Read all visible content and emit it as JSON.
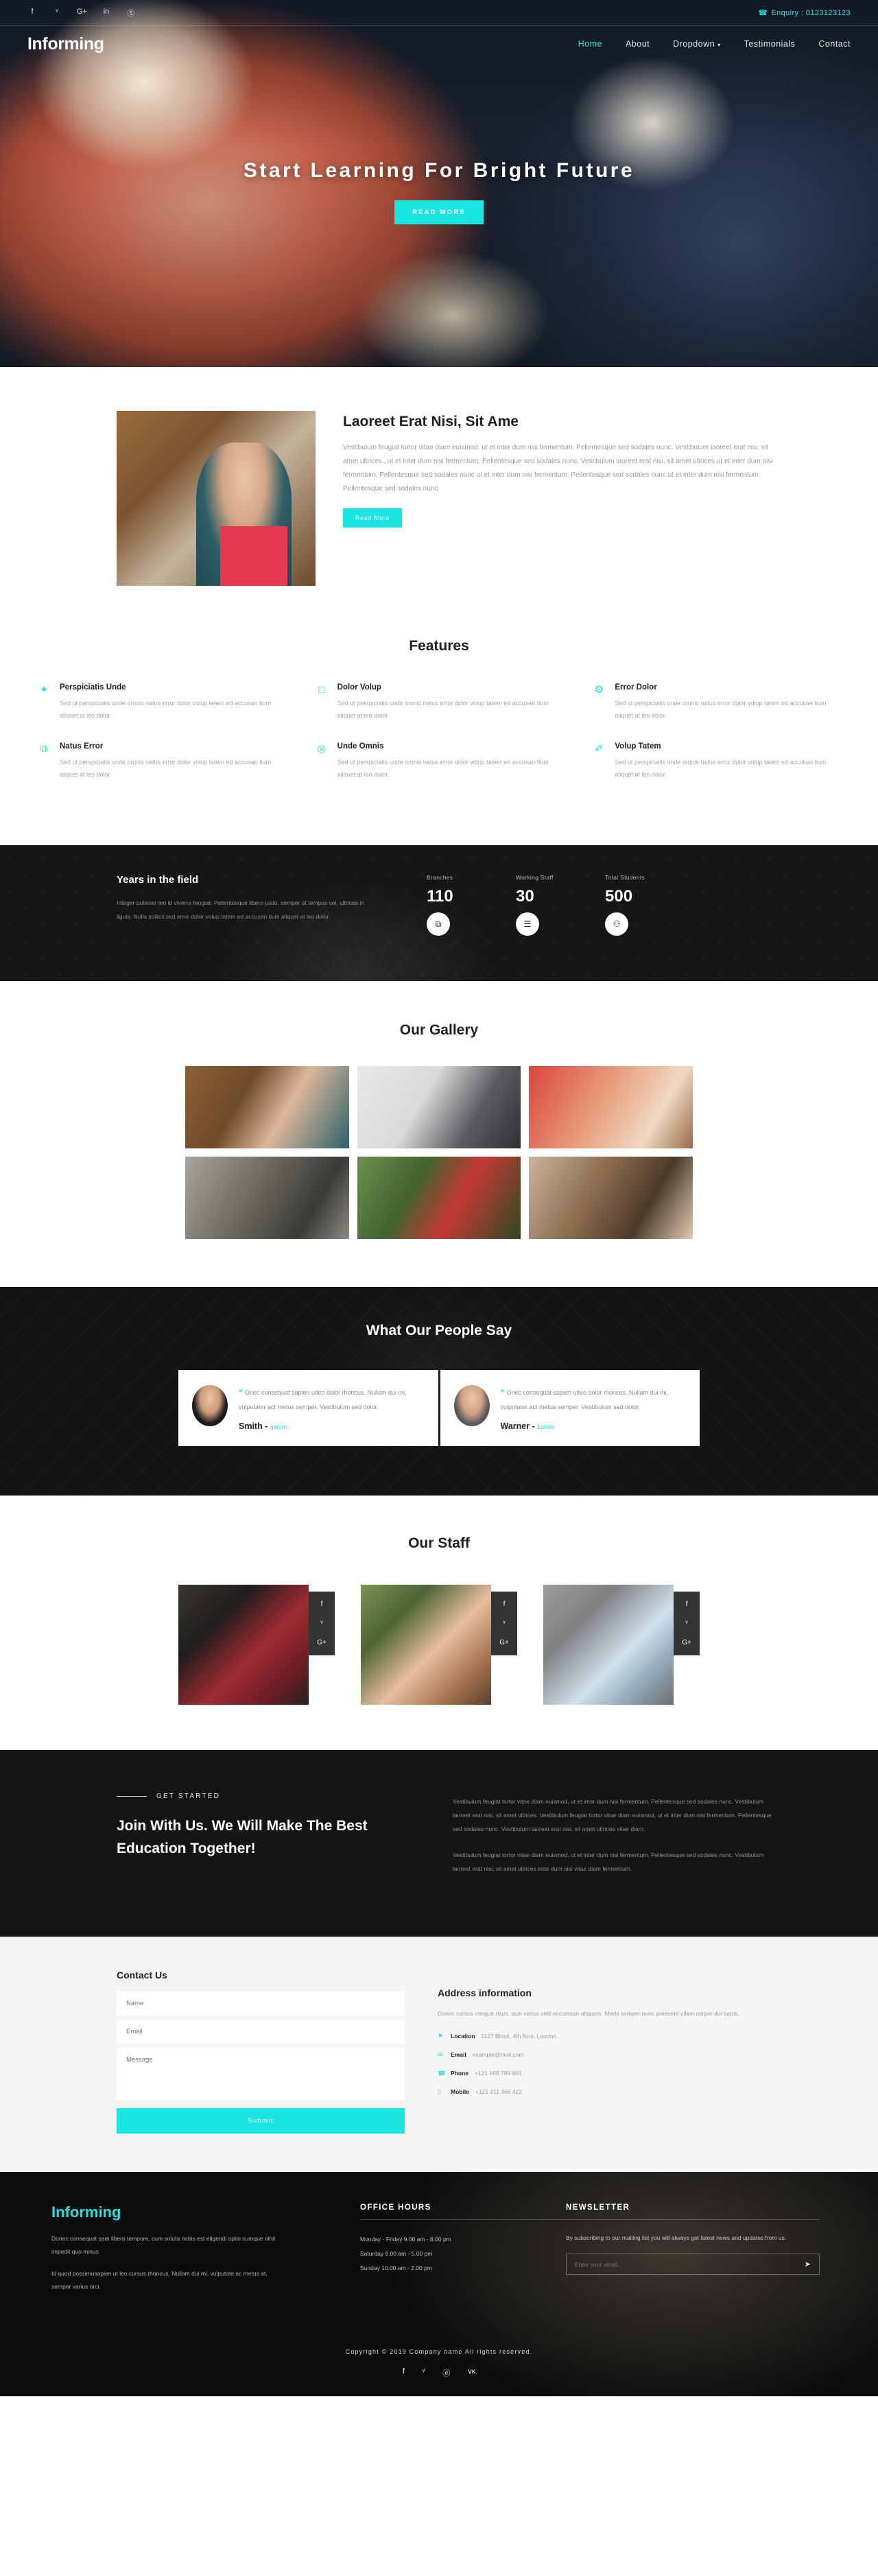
{
  "topbar": {
    "social": [
      "f",
      "ᵛ",
      "G+",
      "in",
      "Ⓢ"
    ],
    "social_names": [
      "facebook",
      "twitter",
      "google-plus",
      "linkedin",
      "stumbleupon"
    ],
    "enquiry_icon": "☎",
    "enquiry": "Enquiry : 0123123123"
  },
  "nav": {
    "logo": "Informing",
    "items": [
      {
        "label": "Home",
        "active": true
      },
      {
        "label": "About",
        "active": false
      },
      {
        "label": "Dropdown",
        "active": false,
        "caret": "▾"
      },
      {
        "label": "Testimonials",
        "active": false
      },
      {
        "label": "Contact",
        "active": false
      }
    ]
  },
  "hero": {
    "title": "Start Learning For Bright Future",
    "button": "READ MORE"
  },
  "about": {
    "title": "Laoreet Erat Nisi, Sit Ame",
    "text": "Vestibulum feugiat tortor vitae diam euismod, ut et inter dum nisi fermentum. Pellentesque sed sodales nunc. Vestibulum laoreet erat nisi, sit amet ultrices., ut et inter dum nisi fermentum. Pellentesque sed sodales nunc. Vestibulum laoreet erat nisi, sit amet ultrices ut et inter dum nisi fermentum. Pellentesque sed sodales nunc ut et inter dum nisi fermentum. Pellentesque sed sodales nunc ut et inter dum nisi fermentum. Pellentesque sed sodales nunc",
    "button": "Read More"
  },
  "features": {
    "title": "Features",
    "items": [
      {
        "icon": "✦",
        "icon_name": "diamond-icon",
        "title": "Perspiciatis Unde",
        "text": "Sed ut perspiciatis unde omnis natus error dolor volup tatem ed accusan tium aliquet at leo dolor."
      },
      {
        "icon": "□",
        "icon_name": "laptop-icon",
        "title": "Dolor Volup",
        "text": "Sed ut perspiciatis unde omnis natus error dolor volup tatem ed accusan tium aliquet at leo dolor."
      },
      {
        "icon": "⚙",
        "icon_name": "gear-icon",
        "title": "Error Dolor",
        "text": "Sed ut perspiciatis unde omnis natus error dolor volup tatem ed accusan tium aliquet at leo dolor."
      },
      {
        "icon": "⧉",
        "icon_name": "copy-icon",
        "title": "Natus Error",
        "text": "Sed ut perspiciatis unde omnis natus error dolor volup tatem ed accusan tium aliquet at leo dolor."
      },
      {
        "icon": "◎",
        "icon_name": "target-icon",
        "title": "Unde Omnis",
        "text": "Sed ut perspiciatis unde omnis natus error dolor volup tatem ed accusan tium aliquet at leo dolor."
      },
      {
        "icon": "✐",
        "icon_name": "brush-icon",
        "title": "Volup Tatem",
        "text": "Sed ut perspiciatis unde omnis natus error dolor volup tatem ed accusan tium aliquet at leo dolor."
      }
    ]
  },
  "stats": {
    "heading": "Years in the field",
    "text": "Integer pulvinar leo id viverra feugiat. Pellentesque libero justo, semper at tempus vel, ultrices in ligula. Nulla sollicit sed.error dolor volup tatem ed accusan tium aliquet at leo dolor.",
    "items": [
      {
        "label": "Branches",
        "value": "110",
        "icon": "⧉",
        "icon_name": "copy-icon"
      },
      {
        "label": "Working Staff",
        "value": "30",
        "icon": "☰",
        "icon_name": "list-icon"
      },
      {
        "label": "Total Students",
        "value": "500",
        "icon": "⚇",
        "icon_name": "users-icon"
      }
    ]
  },
  "gallery": {
    "title": "Our Gallery",
    "items": [
      "g1",
      "g2",
      "g3",
      "g4",
      "g5",
      "g6"
    ]
  },
  "testimonials": {
    "title": "What Our People Say",
    "quote_mark": "❝",
    "items": [
      {
        "text": "Onec consequat sapien utleo dolor rhoncus. Nullam dui mi, vulputater act metus semper. Vestibulum sed dolor.",
        "name": "Smith",
        "role": "Ipsum"
      },
      {
        "text": "Onec consequat sapien utleo dolor rhoncus. Nullam dui mi, vulputater act metus semper. Vestibulum sed dolor.",
        "name": "Warner",
        "role": "Lorem"
      }
    ]
  },
  "staff": {
    "title": "Our Staff",
    "social": [
      "f",
      "ᵛ",
      "G+"
    ],
    "social_names": [
      "facebook-icon",
      "twitter-icon",
      "google-plus-icon"
    ],
    "members": [
      "s1",
      "s2",
      "s3"
    ]
  },
  "get_started": {
    "kicker": "GET STARTED",
    "heading": "Join With Us. We Will Make The Best Education Together!",
    "para1": "Vestibulum feugiat tortor vitae diam euismod, ut et inter dum nisi fermentum. Pellentesque sed sodales nunc. Vestibulum laoreet erat nisi, sit amet ultrices. Vestibulum feugiat tortor vitae diam euismod, ut et inter dum nisi fermentum. Pellentesque sed sodales nunc. Vestibulum laoreet erat nisi, sit amet ultrices vitae diam.",
    "para2": "Vestibulum feugiat tortor vitae diam euismod, ut et inter dum nisi fermentum. Pellentesque sed sodales nunc. Vestibulum laoreet erat nisi, sit amet ultrices inter dum nisi vitae diam fermentum."
  },
  "contact": {
    "title": "Contact Us",
    "name_placeholder": "Name",
    "email_placeholder": "Email",
    "message_placeholder": "Message",
    "submit": "Submit",
    "address_title": "Address information",
    "address_text": "Donec cursus congue risus, quis varius velit accumsan aliquam. Morbi semper nunc praesent ullam corper dui turpis.",
    "items": [
      {
        "icon": "⚑",
        "icon_name": "location-pin-icon",
        "label": "Location",
        "value": "1127 Block, 4th floor, London."
      },
      {
        "icon": "✉",
        "icon_name": "email-icon",
        "label": "Email",
        "value": "example@mail.com"
      },
      {
        "icon": "☎",
        "icon_name": "phone-icon",
        "label": "Phone",
        "value": "+121 568 789 901"
      },
      {
        "icon": "▯",
        "icon_name": "mobile-icon",
        "label": "Mobile",
        "value": "+121 211 366 422"
      }
    ]
  },
  "footer": {
    "logo": "Informing",
    "about1": "Donec consequat sam libero tempore, cum soluta nobis est eligendi optio cumque nihil impedit quo minus",
    "about2": "Id quod possimusapien ut leo cursus rhoncus. Nullam dui mi, vulputate ac metus at, semper varius orci.",
    "hours_title": "OFFICE HOURS",
    "hours": [
      "Monday - Friday 9.00 am - 8.00 pm",
      "Saturday 9.00 am - 5.00 pm",
      "Sunday 10.00 am - 2.00 pm"
    ],
    "newsletter_title": "NEWSLETTER",
    "newsletter_text": "By subscribing to our mailing list you will always get latest news and updates from us.",
    "newsletter_placeholder": "Enter your email...",
    "newsletter_icon": "➤",
    "copyright": "Copyright © 2019 Company name All rights reserved.",
    "social": [
      "f",
      "ᵛ",
      "ⓓ",
      "ᴠᴋ"
    ],
    "social_names": [
      "facebook-icon",
      "twitter-icon",
      "dribbble-icon",
      "vk-icon"
    ]
  },
  "colors": {
    "accent": "#19e6e0",
    "dark": "#151515",
    "light": "#f5f5f5"
  }
}
